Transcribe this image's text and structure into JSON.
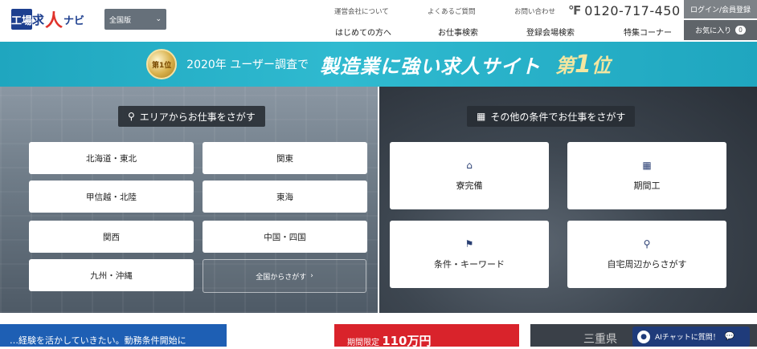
{
  "header": {
    "logo": {
      "mark": "工場",
      "person": "人",
      "text1": "求",
      "text2": "ナビ"
    },
    "region": {
      "label": "全国版"
    },
    "sublinks": [
      "運営会社について",
      "よくあるご質問",
      "お問い合わせ"
    ],
    "phone": {
      "icon": "free-dial-icon",
      "number": "0120-717-450"
    },
    "nav": [
      "はじめての方へ",
      "お仕事検索",
      "登録会場検索",
      "特集コーナー"
    ],
    "login": "ログイン/会員登録",
    "favorites": {
      "label": "お気に入り",
      "count": "0"
    }
  },
  "banner": {
    "medal": "第1位",
    "lead": "2020年 ユーザー調査で",
    "headline": "製造業に強い求人サイト",
    "rank_prefix": "第",
    "rank_number": "1",
    "rank_suffix": "位"
  },
  "area_search": {
    "heading": "エリアからお仕事をさがす",
    "areas": [
      "北海道・東北",
      "関東",
      "甲信越・北陸",
      "東海",
      "関西",
      "中国・四国",
      "九州・沖縄"
    ],
    "all_label": "全国からさがす"
  },
  "condition_search": {
    "heading": "その他の条件でお仕事をさがす",
    "items": [
      {
        "label": "寮完備",
        "icon": "dormitory-icon"
      },
      {
        "label": "期間工",
        "icon": "calendar-icon"
      },
      {
        "label": "条件・キーワード",
        "icon": "flag-icon"
      },
      {
        "label": "自宅周辺からさがす",
        "icon": "location-pin-icon"
      }
    ]
  },
  "bottom": {
    "strip_a": "…経験を活かしていきたい。動務条件開始に",
    "strip_b_label": "期間限定",
    "strip_b_amount": "110万円",
    "strip_c": "三重県"
  },
  "chat": {
    "label": "AIチャットに質問！"
  }
}
